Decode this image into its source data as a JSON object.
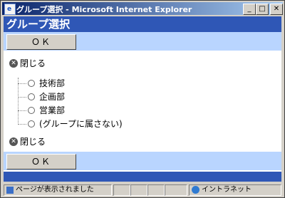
{
  "window": {
    "title": "グループ選択 - Microsoft Internet Explorer",
    "app_icon": "ie-icon",
    "controls": [
      "minimize",
      "maximize",
      "close"
    ]
  },
  "page": {
    "heading": "グループ選択",
    "ok_label": "ＯＫ",
    "close_label": "閉じる",
    "groups": [
      {
        "label": "技術部"
      },
      {
        "label": "企画部"
      },
      {
        "label": "営業部"
      },
      {
        "label": "(グループに属さない)"
      }
    ]
  },
  "statusbar": {
    "message": "ページが表示されました",
    "zone": "イントラネット"
  },
  "colors": {
    "header_bg": "#2f57b6",
    "button_bar_bg": "#b9d5ff"
  }
}
